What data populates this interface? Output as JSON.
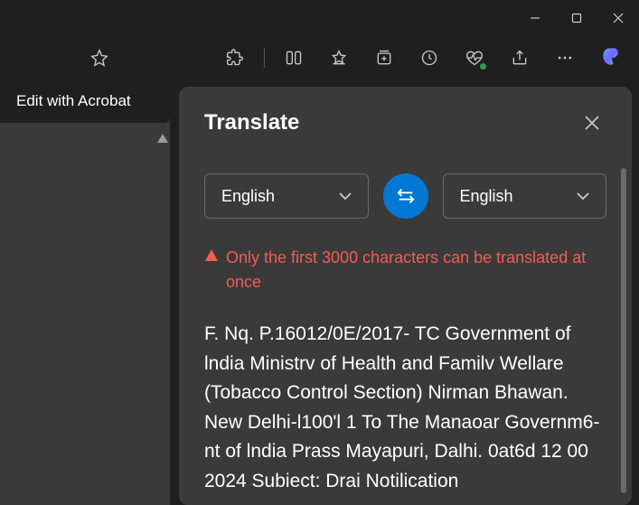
{
  "window": {
    "acrobat_label": "Edit with Acrobat"
  },
  "translate": {
    "title": "Translate",
    "from_lang": "English",
    "to_lang": "English",
    "warning": "Only the first 3000 characters can be translated at once",
    "body": "F. Nq. P.16012/0E/2017- TC Government of lndia Ministrv of Health and Familv Wellare (Tobacco Control Section) Nirman Bhawan. New Delhi-l100'l 1 To The Manaoar Governm6-nt of lndia Prass Mayapuri, Dalhi. 0at6d 12 00 2024 Subiect: Drai Notilication"
  }
}
